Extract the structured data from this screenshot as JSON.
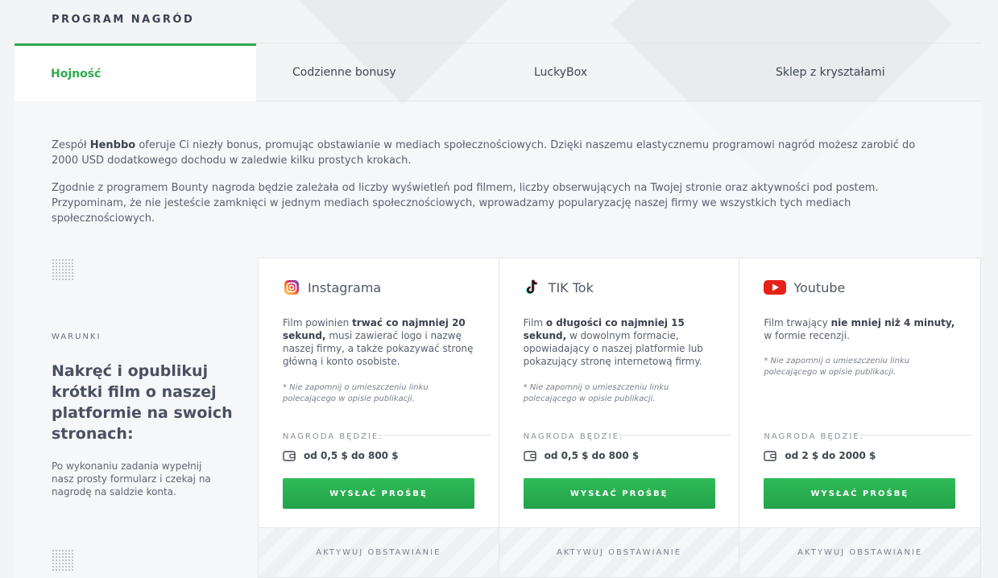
{
  "header": {
    "title": "PROGRAM NAGRÓD"
  },
  "tabs": [
    {
      "label": "Hojność",
      "active": true
    },
    {
      "label": "Codzienne bonusy",
      "active": false
    },
    {
      "label": "LuckyBox",
      "active": false
    },
    {
      "label": "Sklep z kryształami",
      "active": false
    }
  ],
  "intro": {
    "p1_pre": "Zespół ",
    "p1_brand": "Henbbo",
    "p1_post": " oferuje Ci niezły bonus, promując obstawianie w mediach społecznościowych. Dzięki naszemu elastycznemu programowi nagród możesz zarobić do 2000 USD dodatkowego dochodu w zaledwie kilku prostych krokach.",
    "p2": "Zgodnie z programem Bounty nagroda będzie zależała od liczby wyświetleń pod filmem, liczby obserwujących na Twojej stronie oraz aktywności pod postem. Przypominam, że nie jesteście zamknięci w jednym mediach społecznościowych, wprowadzamy popularyzację naszej firmy we wszystkich tych mediach społecznościowych."
  },
  "conditions": {
    "label": "WARUNKI",
    "title": "Nakręć i opublikuj krótki film o naszej platformie na swoich stronach:",
    "description": "Po wykonaniu zadania wypełnij nasz prosty formularz i czekaj na nagrodę na saldzie konta."
  },
  "cards": [
    {
      "name": "Instagrama",
      "icon": "instagram-icon",
      "text_pre": "Film powinien ",
      "text_bold": "trwać co najmniej 20 sekund,",
      "text_post": " musi zawierać logo i nazwę naszej firmy, a także pokazywać stronę główną i konto osobiste.",
      "note": "* Nie zapomnij o umieszczeniu linku polecającego w opisie publikacji.",
      "reward_label": "NAGRODA BĘDZIE:",
      "reward": "od 0,5 $ do 800 $",
      "button": "WYSŁAĆ PROŚBĘ",
      "footer": "AKTYWUJ OBSTAWIANIE"
    },
    {
      "name": "TIK Tok",
      "icon": "tiktok-icon",
      "text_pre": "Film ",
      "text_bold": "o długości co najmniej 15 sekund,",
      "text_post": " w dowolnym formacie, opowiadający o naszej platformie lub pokazujący stronę internetową firmy.",
      "note": "* Nie zapomnij o umieszczeniu linku polecającego w opisie publikacji.",
      "reward_label": "NAGRODA BĘDZIE:",
      "reward": "od 0,5 $ do 800 $",
      "button": "WYSŁAĆ PROŚBĘ",
      "footer": "AKTYWUJ OBSTAWIANIE"
    },
    {
      "name": "Youtube",
      "icon": "youtube-icon",
      "text_pre": "Film trwający ",
      "text_bold": "nie mniej niż 4 minuty,",
      "text_post": " w formie recenzji.",
      "note": "* Nie zapomnij o umieszczeniu linku polecającego w opisie publikacji.",
      "reward_label": "NAGRODA BĘDZIE:",
      "reward": "od 2 $ do 2000 $",
      "button": "WYSŁAĆ PROŚBĘ",
      "footer": "AKTYWUJ OBSTAWIANIE"
    }
  ],
  "colors": {
    "accent": "#2eaa4f",
    "instagram": "#d62976",
    "youtube": "#e62117",
    "tiktok": "#111111"
  }
}
